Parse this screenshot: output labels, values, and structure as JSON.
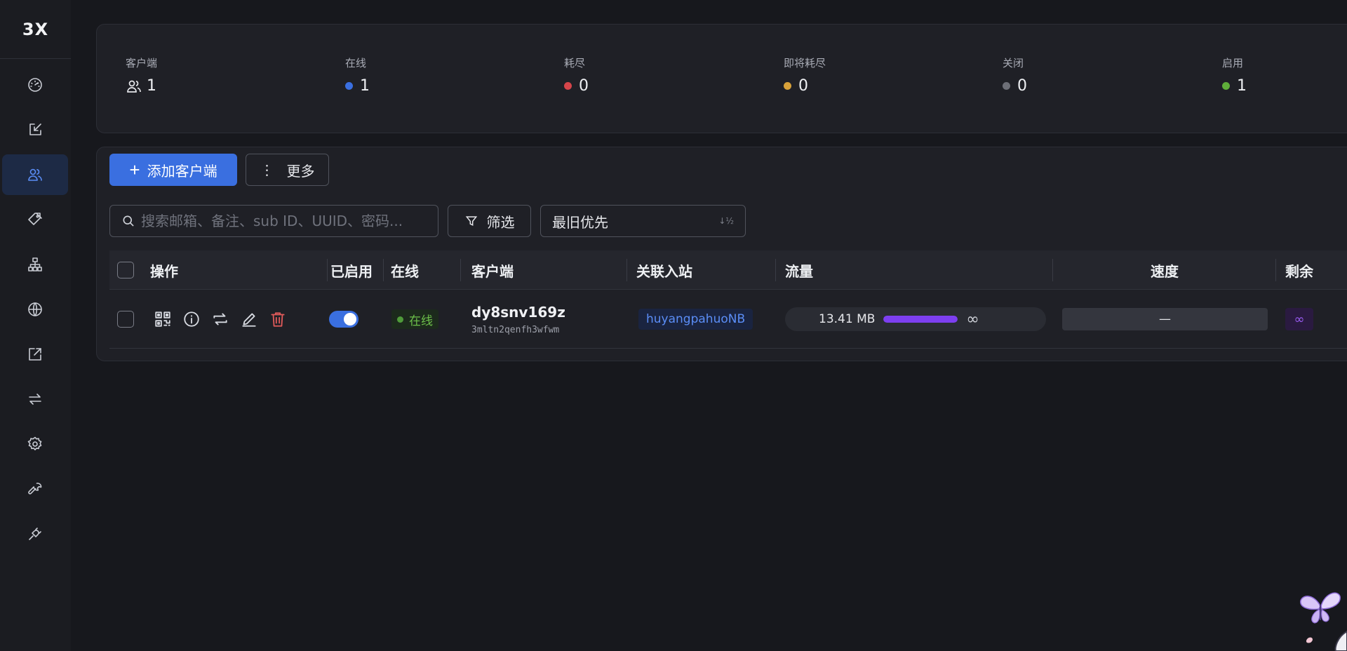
{
  "app": {
    "logo": "3X"
  },
  "sidebar": {
    "items": [
      {
        "icon": "dashboard-gauge-icon"
      },
      {
        "icon": "inbound-edit-icon"
      },
      {
        "icon": "clients-users-icon",
        "active": true
      },
      {
        "icon": "tag-icon"
      },
      {
        "icon": "network-hierarchy-icon"
      },
      {
        "icon": "globe-icon"
      },
      {
        "icon": "external-link-icon"
      },
      {
        "icon": "transfer-arrows-icon"
      },
      {
        "icon": "settings-gear-icon"
      },
      {
        "icon": "wrench-icon"
      },
      {
        "icon": "plug-icon"
      }
    ]
  },
  "stats": [
    {
      "label": "客户端",
      "value": "1",
      "icon": "users-icon"
    },
    {
      "label": "在线",
      "value": "1",
      "color": "#3a6fe0"
    },
    {
      "label": "耗尽",
      "value": "0",
      "color": "#d6454a"
    },
    {
      "label": "即将耗尽",
      "value": "0",
      "color": "#d9a23a"
    },
    {
      "label": "关闭",
      "value": "0",
      "color": "#6d6f77"
    },
    {
      "label": "启用",
      "value": "1",
      "color": "#5fae3a"
    }
  ],
  "toolbar": {
    "add_label": "添加客户端",
    "more_label": "更多",
    "search_placeholder": "搜索邮箱、备注、sub ID、UUID、密码...",
    "filter_label": "筛选",
    "sort_value": "最旧优先"
  },
  "table": {
    "headers": {
      "actions": "操作",
      "enabled": "已启用",
      "online": "在线",
      "client": "客户端",
      "inbound": "关联入站",
      "traffic": "流量",
      "speed": "速度",
      "remaining": "剩余"
    },
    "rows": [
      {
        "enabled": true,
        "online_label": "在线",
        "client_name": "dy8snv169z",
        "client_sub": "3mltn2qenfh3wfwm",
        "inbound": "huyangpahuoNB",
        "traffic_used": "13.41 MB",
        "traffic_limit": "∞",
        "speed": "—",
        "remaining": "∞"
      }
    ]
  },
  "colors": {
    "accent": "#3a6fe0",
    "online_green": "#6cbf4a",
    "traffic_purple": "#7d3ff0",
    "danger": "#e05a5a"
  }
}
